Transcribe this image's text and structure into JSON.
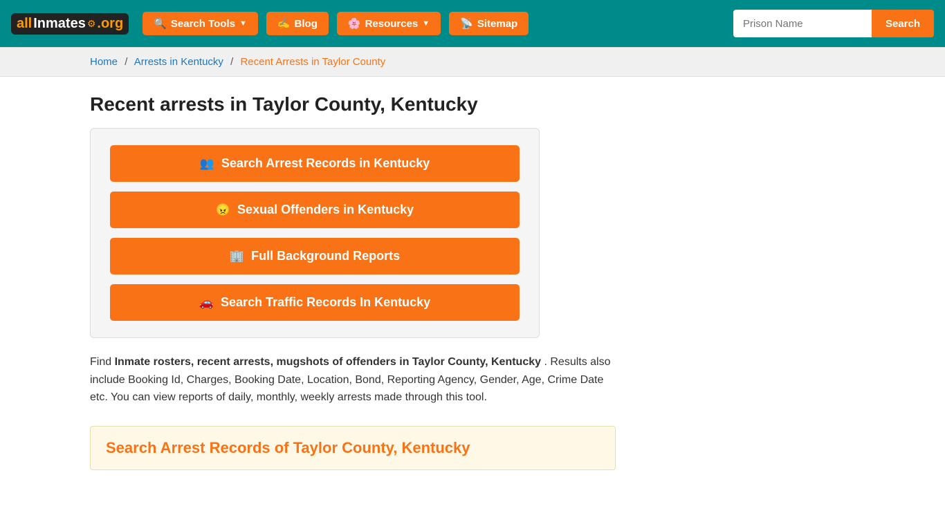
{
  "site": {
    "logo_all": "all",
    "logo_inmates": "inmates",
    "logo_org": ".org"
  },
  "navbar": {
    "search_tools_label": "Search Tools",
    "blog_label": "Blog",
    "resources_label": "Resources",
    "sitemap_label": "Sitemap",
    "prison_name_placeholder": "Prison Name",
    "search_btn_label": "Search"
  },
  "breadcrumb": {
    "home": "Home",
    "arrests_in_ky": "Arrests in Kentucky",
    "recent_arrests": "Recent Arrests in Taylor County"
  },
  "main": {
    "page_title": "Recent arrests in Taylor County, Kentucky",
    "action_buttons": [
      {
        "id": "btn-arrest",
        "icon": "users",
        "label": "Search Arrest Records in Kentucky"
      },
      {
        "id": "btn-offenders",
        "icon": "angry",
        "label": "Sexual Offenders in Kentucky"
      },
      {
        "id": "btn-background",
        "icon": "building",
        "label": "Full Background Reports"
      },
      {
        "id": "btn-traffic",
        "icon": "car",
        "label": "Search Traffic Records In Kentucky"
      }
    ],
    "description_part1": "Find ",
    "description_bold": "Inmate rosters, recent arrests, mugshots of offenders in Taylor County, Kentucky",
    "description_part2": ". Results also include Booking Id, Charges, Booking Date, Location, Bond, Reporting Agency, Gender, Age, Crime Date etc. You can view reports of daily, monthly, weekly arrests made through this tool.",
    "section_title": "Search Arrest Records of Taylor County, Kentucky"
  }
}
